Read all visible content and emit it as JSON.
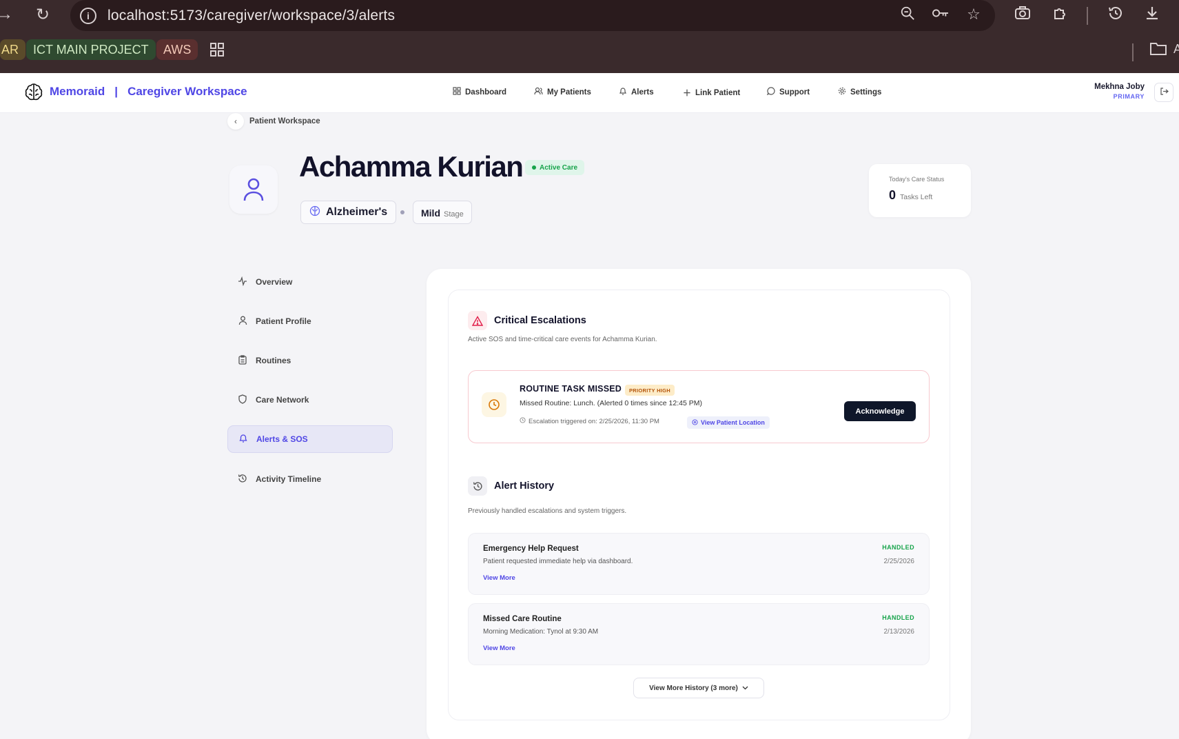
{
  "browser": {
    "url": "localhost:5173/caregiver/workspace/3/alerts",
    "bookmarks": [
      {
        "label": "AR"
      },
      {
        "label": "ICT MAIN PROJECT"
      },
      {
        "label": "AWS"
      }
    ],
    "trailing_char": "A"
  },
  "app": {
    "brand": "Memoraid",
    "brand_sep": "|",
    "workspace": "Caregiver Workspace",
    "nav": [
      {
        "label": "Dashboard",
        "icon": "grid-icon"
      },
      {
        "label": "My Patients",
        "icon": "users-icon"
      },
      {
        "label": "Alerts",
        "icon": "bell-icon"
      },
      {
        "label": "Link Patient",
        "icon": "plus-icon"
      },
      {
        "label": "Support",
        "icon": "chat-icon"
      },
      {
        "label": "Settings",
        "icon": "gear-icon"
      }
    ],
    "user": {
      "name": "Mekhna Joby",
      "role": "PRIMARY"
    }
  },
  "breadcrumb": {
    "label": "Patient Workspace"
  },
  "patient": {
    "name": "Achamma Kurian",
    "status": "Active Care",
    "diagnosis": "Alzheimer's",
    "stage_value": "Mild",
    "stage_label": "Stage"
  },
  "care_status": {
    "title": "Today's Care Status",
    "count": "0",
    "suffix": "Tasks Left"
  },
  "sidebar": {
    "items": [
      {
        "label": "Overview",
        "icon": "activity-icon"
      },
      {
        "label": "Patient Profile",
        "icon": "user-icon"
      },
      {
        "label": "Routines",
        "icon": "clipboard-icon"
      },
      {
        "label": "Care Network",
        "icon": "shield-icon"
      },
      {
        "label": "Alerts & SOS",
        "icon": "bell-icon",
        "active": true
      },
      {
        "label": "Activity Timeline",
        "icon": "history-icon"
      }
    ]
  },
  "critical": {
    "title": "Critical Escalations",
    "subtitle": "Active SOS and time-critical care events for Achamma Kurian.",
    "alert": {
      "title": "ROUTINE TASK MISSED",
      "priority": "PRIORITY HIGH",
      "description": "Missed Routine: Lunch. (Alerted 0 times since 12:45 PM)",
      "triggered": "Escalation triggered on: 2/25/2026, 11:30 PM",
      "location_link": "View Patient Location",
      "action": "Acknowledge"
    }
  },
  "history": {
    "title": "Alert History",
    "subtitle": "Previously handled escalations and system triggers.",
    "items": [
      {
        "title": "Emergency Help Request",
        "description": "Patient requested immediate help via dashboard.",
        "link": "View More",
        "status": "HANDLED",
        "date": "2/25/2026"
      },
      {
        "title": "Missed Care Routine",
        "description": "Morning Medication: Tynol at 9:30 AM",
        "link": "View More",
        "status": "HANDLED",
        "date": "2/13/2026"
      }
    ],
    "more_button": "View More History (3 more)"
  }
}
